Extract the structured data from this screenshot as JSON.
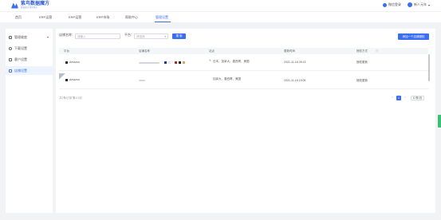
{
  "header": {
    "logo_title": "紫鸟数据魔方",
    "logo_subtitle": "数据驱动 精准增长",
    "wechat_label": "微信登录",
    "user_label": "新人元年"
  },
  "nav": {
    "items": [
      {
        "label": "首页"
      },
      {
        "label": "ERP运营"
      },
      {
        "label": "ERP运营"
      },
      {
        "label": "ERP市场"
      },
      {
        "label": "帮助中心"
      },
      {
        "label": "管理设置"
      }
    ]
  },
  "sidebar": {
    "items": [
      {
        "label": "管理维度"
      },
      {
        "label": "下载设置"
      },
      {
        "label": "客户设置"
      },
      {
        "label": "店铺设置"
      }
    ]
  },
  "filters": {
    "shop_label": "店铺名称：",
    "shop_placeholder": "请输入",
    "platform_label": "平台：",
    "platform_placeholder": "请选择",
    "search_button": "搜 索",
    "add_button": "添加一个店铺授权"
  },
  "table": {
    "headers": [
      "平台",
      "店铺名称",
      "站点",
      "更新时间",
      "授权方式"
    ],
    "rows": [
      {
        "platform": "Amazon",
        "sites": "日本、加拿大、墨西哥、美国",
        "updated": "2021-11-16 09:13",
        "method": "授权更新"
      },
      {
        "platform": "Amazon",
        "sites": "加拿大、墨西哥、美国",
        "updated": "2021-11-16 19:05",
        "method": "授权更新"
      }
    ],
    "footer": "共2条记录 第1/1页"
  },
  "pagination": {
    "prev": "‹",
    "current": "1",
    "next": "›",
    "page_size": "10条/页"
  },
  "colors": {
    "accent": "#3a6ff2",
    "swatches": [
      "#1f2f8f",
      "#e8e8e8",
      "#b3202a",
      "#1a1a1a",
      "#e0a460"
    ]
  }
}
